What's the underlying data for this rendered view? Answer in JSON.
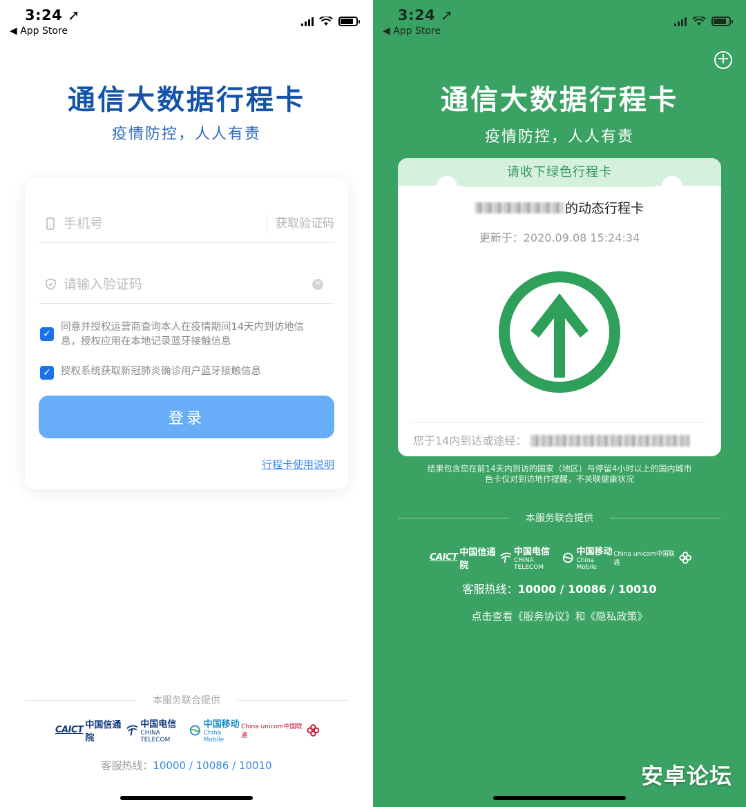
{
  "left": {
    "status": {
      "time": "3:24 ➚",
      "back": "◀ App Store"
    },
    "title": "通信大数据行程卡",
    "subtitle": "疫情防控，人人有责",
    "phone_placeholder": "手机号",
    "get_code": "获取验证码",
    "code_placeholder": "请输入验证码",
    "consent_1": "同意并授权运营商查询本人在疫情期间14天内到访地信息，授权应用在本地记录蓝牙接触信息",
    "consent_2": "授权系统获取新冠肺炎确诊用户蓝牙接触信息",
    "login_label": "登录",
    "guide_link": "行程卡使用说明",
    "footer_provider": "本服务联合提供",
    "logos": {
      "caict": "CAICT",
      "caict_cn": "中国信通院",
      "telecom": "中国电信",
      "telecom_en": "CHINA TELECOM",
      "mobile": "中国移动",
      "mobile_en": "China Mobile",
      "unicom": "China unicom中国联通"
    },
    "hotline_label": "客服热线：",
    "hotline": "10000 / 10086 / 10010"
  },
  "right": {
    "status": {
      "time": "3:24 ➚",
      "back": "◀ App Store"
    },
    "title": "通信大数据行程卡",
    "subtitle": "疫情防控，人人有责",
    "card_header": "请收下绿色行程卡",
    "owner_suffix": "的动态行程卡",
    "updated": "更新于：2020.09.08 15:24:34",
    "route_label": "您于14内到达或途经：",
    "note_1": "结果包含您在前14天内到访的国家（地区）与停留4小时以上的国内城市",
    "note_2": "色卡仅对到访地作提醒，不关联健康状况",
    "footer_provider": "本服务联合提供",
    "hotline_label": "客服热线：",
    "hotline": "10000 / 10086 / 10010",
    "policy": "点击查看《服务协议》和《隐私政策》",
    "watermark": "安卓论坛",
    "colors": {
      "background": "#3aa262",
      "arrow": "#2fa05a"
    }
  }
}
